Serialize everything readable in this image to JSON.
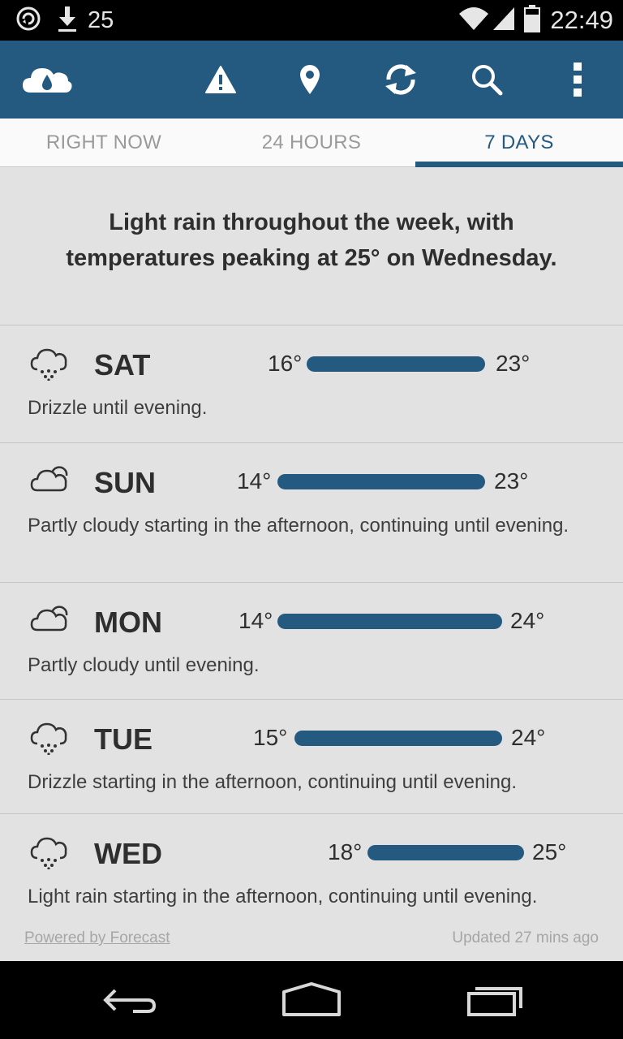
{
  "status_bar": {
    "notification_count": "25",
    "time": "22:49",
    "icons": [
      "sync-icon",
      "download-icon",
      "wifi-icon",
      "signal-icon",
      "battery-icon"
    ]
  },
  "app_bar": {
    "icons": [
      "cloud-rain-logo-icon",
      "warning-icon",
      "location-icon",
      "refresh-icon",
      "search-icon",
      "overflow-menu-icon"
    ],
    "color": "#245a80"
  },
  "tabs": [
    {
      "label": "RIGHT NOW",
      "active": false
    },
    {
      "label": "24 HOURS",
      "active": false
    },
    {
      "label": "7 DAYS",
      "active": true
    }
  ],
  "summary": "Light rain throughout the week, with temperatures peaking at 25° on Wednesday.",
  "days": [
    {
      "name": "SAT",
      "icon": "drizzle-icon",
      "low": "16°",
      "high": "23°",
      "desc": "Drizzle until evening."
    },
    {
      "name": "SUN",
      "icon": "partly-cloudy-icon",
      "low": "14°",
      "high": "23°",
      "desc": "Partly cloudy starting in the afternoon, continuing until evening."
    },
    {
      "name": "MON",
      "icon": "partly-cloudy-icon",
      "low": "14°",
      "high": "24°",
      "desc": "Partly cloudy until evening."
    },
    {
      "name": "TUE",
      "icon": "drizzle-icon",
      "low": "15°",
      "high": "24°",
      "desc": "Drizzle starting in the afternoon, continuing until evening."
    },
    {
      "name": "WED",
      "icon": "drizzle-icon",
      "low": "18°",
      "high": "25°",
      "desc": "Light rain starting in the afternoon, continuing until evening."
    }
  ],
  "footer": {
    "powered_by": "Powered by Forecast",
    "updated": "Updated 27 mins ago"
  },
  "nav_bar": {
    "icons": [
      "back-icon",
      "home-icon",
      "recents-icon"
    ]
  }
}
